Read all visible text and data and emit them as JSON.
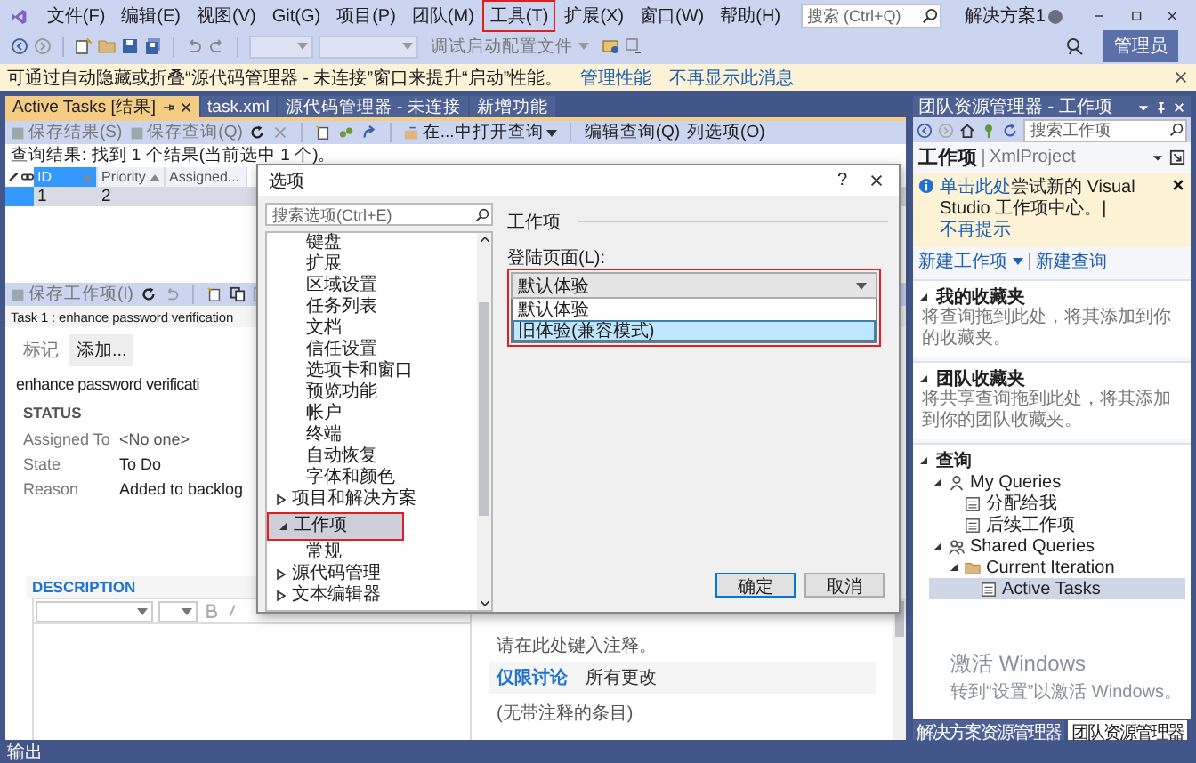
{
  "menu": [
    {
      "label": "文件(F)",
      "highlighted": false
    },
    {
      "label": "编辑(E)",
      "highlighted": false
    },
    {
      "label": "视图(V)",
      "highlighted": false
    },
    {
      "label": "Git(G)",
      "highlighted": false
    },
    {
      "label": "项目(P)",
      "highlighted": false
    },
    {
      "label": "团队(M)",
      "highlighted": false
    },
    {
      "label": "工具(T)",
      "highlighted": true
    },
    {
      "label": "扩展(X)",
      "highlighted": false
    },
    {
      "label": "窗口(W)",
      "highlighted": false
    },
    {
      "label": "帮助(H)",
      "highlighted": false
    }
  ],
  "search": {
    "placeholder": "搜索 (Ctrl+Q)"
  },
  "solution_name": "解决方案1",
  "toolbar": {
    "config_label": "调试启动配置文件",
    "admin_button": "管理员"
  },
  "info_bar": {
    "message": "可通过自动隐藏或折叠“源代码管理器 - 未连接”窗口来提升“启动”性能。",
    "links": [
      "管理性能",
      "不再显示此消息"
    ]
  },
  "document_tabs": [
    {
      "label": "Active Tasks [结果]",
      "selected": true
    },
    {
      "label": "task.xml",
      "selected": false
    },
    {
      "label": "源代码管理器 - 未连接",
      "selected": false
    },
    {
      "label": "新增功能",
      "selected": false
    }
  ],
  "query_toolbar": {
    "save_results": "保存结果(S)",
    "save_query": "保存查询(Q)",
    "open_in": "在...中打开查询",
    "edit_query": "编辑查询(Q)",
    "column_options": "列选项(O)"
  },
  "query_result": "查询结果: 找到 1 个结果(当前选中 1 个)。",
  "grid": {
    "columns": [
      {
        "label": "ID",
        "selected": true
      },
      {
        "label": "Priority",
        "selected": false
      },
      {
        "label": "Assigned...",
        "selected": false
      }
    ],
    "rows": [
      {
        "selected": true,
        "cells": [
          "1",
          "2"
        ]
      }
    ]
  },
  "work_item_toolbar": {
    "save": "保存工作项(I)"
  },
  "work_item": {
    "heading": "Task 1 : enhance password verification",
    "tags_label": "标记",
    "add_button": "添加...",
    "title": "enhance password verificati",
    "status_header": "STATUS",
    "fields": [
      {
        "label": "Assigned To",
        "value": "<No one>"
      },
      {
        "label": "State",
        "value": "To Do"
      },
      {
        "label": "Reason",
        "value": "Added to backlog"
      }
    ],
    "description_header": "DESCRIPTION"
  },
  "notes": {
    "placeholder": "请在此处键入注释。",
    "tabs": [
      {
        "label": "仅限讨论",
        "selected": true
      },
      {
        "label": "所有更改",
        "selected": false
      }
    ],
    "empty": "(无带注释的条目)"
  },
  "options_dialog": {
    "title": "选项",
    "help": "?",
    "search_placeholder": "搜索选项(Ctrl+E)",
    "tree_continuation": [
      "键盘",
      "扩展",
      "区域设置",
      "任务列表",
      "文档",
      "信任设置",
      "选项卡和窗口",
      "预览功能",
      "帐户",
      "终端",
      "自动恢复",
      "字体和颜色"
    ],
    "tree": [
      {
        "label": "项目和解决方案",
        "expanded": false,
        "selected": false,
        "highlighted": false
      },
      {
        "label": "工作项",
        "expanded": true,
        "selected": true,
        "highlighted": true,
        "children": [
          {
            "label": "常规",
            "selected": false
          }
        ]
      },
      {
        "label": "源代码管理",
        "expanded": false,
        "selected": false,
        "highlighted": false
      },
      {
        "label": "文本编辑器",
        "expanded": false,
        "selected": false,
        "highlighted": false
      }
    ],
    "section_title": "工作项",
    "field_label": "登陆页面(L):",
    "combo_value": "默认体验",
    "highlighted": true,
    "dropdown_options": [
      {
        "label": "默认体验",
        "selected": false
      },
      {
        "label": "旧体验(兼容模式)",
        "selected": true
      }
    ],
    "buttons": [
      {
        "label": "确定",
        "default": true
      },
      {
        "label": "取消",
        "default": false
      }
    ]
  },
  "team_explorer": {
    "title": "团队资源管理器 - 工作项",
    "search_placeholder": "搜索工作项",
    "page_title": "工作项",
    "project": "XmlProject",
    "banner": {
      "link": "单击此处",
      "text": "尝试新的 Visual Studio 工作项中心。|",
      "dismiss": "不再提示"
    },
    "actions": [
      "新建工作项",
      "新建查询"
    ],
    "sections": [
      {
        "title": "我的收藏夹",
        "expanded": true,
        "text": "将查询拖到此处，将其添加到你的收藏夹。"
      },
      {
        "title": "团队收藏夹",
        "expanded": true,
        "text": "将共享查询拖到此处，将其添加到你的团队收藏夹。"
      }
    ],
    "queries": {
      "title": "查询",
      "expanded": true,
      "tree": [
        {
          "label": "My Queries",
          "kind": "person",
          "expanded": true,
          "selected": false,
          "children": [
            {
              "label": "分配给我",
              "kind": "query",
              "selected": false
            },
            {
              "label": "后续工作项",
              "kind": "query",
              "selected": false
            }
          ]
        },
        {
          "label": "Shared Queries",
          "kind": "people",
          "expanded": true,
          "selected": false,
          "children": [
            {
              "label": "Current Iteration",
              "kind": "folder",
              "expanded": true,
              "selected": false,
              "children": [
                {
                  "label": "Active Tasks",
                  "kind": "query",
                  "selected": true
                }
              ]
            }
          ]
        }
      ]
    },
    "bottom_tabs": [
      {
        "label": "解决方案资源管理器",
        "selected": false
      },
      {
        "label": "团队资源管理器",
        "selected": true
      }
    ]
  },
  "activation": {
    "title": "激活 Windows",
    "text": "转到“设置”以激活 Windows。"
  },
  "output_bar": "输出"
}
